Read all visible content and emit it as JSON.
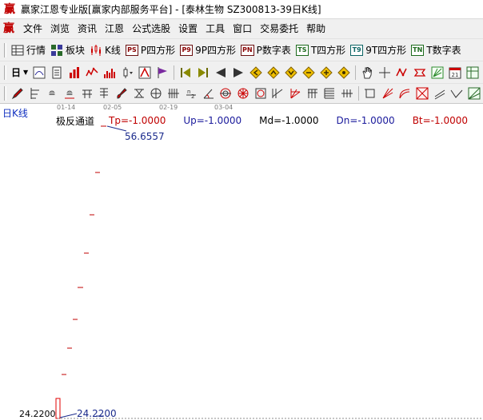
{
  "window": {
    "logo_glyph": "赢",
    "title": "赢家江恩专业版[赢家内部服务平台] - [泰林生物   SZ300813-39日K线]"
  },
  "menu": {
    "logo_glyph": "赢",
    "items": [
      "文件",
      "浏览",
      "资讯",
      "江恩",
      "公式选股",
      "设置",
      "工具",
      "窗口",
      "交易委托",
      "帮助"
    ]
  },
  "toolbar1": {
    "quote_label": "行情",
    "sector_label": "板块",
    "kline_label": "K线",
    "p_square_label": "P四方形",
    "p_square_box": "PS",
    "p9_square_label": "9P四方形",
    "p9_square_box": "P9",
    "p_number_label": "P数字表",
    "p_number_box": "PN",
    "t_square_label": "T四方形",
    "t_square_box": "TS",
    "t9_square_label": "9T四方形",
    "t9_square_box": "T9",
    "t_number_label": "T数字表",
    "t_number_box": "TN"
  },
  "toolbar2": {
    "period_dropdown_label": "日"
  },
  "chart": {
    "period_label": "日K线",
    "date_ticks": [
      "01-14",
      "02-05",
      "02-19",
      "03-04"
    ],
    "indicator": {
      "name": "极反通道",
      "tp": "Tp=-1.0000",
      "up": "Up=-1.0000",
      "md": "Md=-1.0000",
      "dn": "Dn=-1.0000",
      "bt": "Bt=-1.0000"
    },
    "high_price_label": "56.6557",
    "low_price_label": "24.2200",
    "axis_low_price": "24.2200",
    "colors": {
      "accent_red": "#c00000",
      "price_blue": "#1a2a8c",
      "candle_red": "#e00000"
    }
  }
}
